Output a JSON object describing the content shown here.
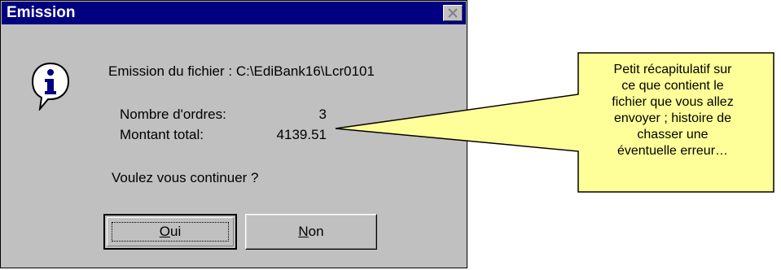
{
  "dialog": {
    "title": "Emission",
    "message": "Emission du fichier : C:\\EdiBank16\\Lcr0101",
    "orders_label": "Nombre d'ordres:",
    "orders_value": "3",
    "total_label": "Montant total:",
    "total_value": "4139.51",
    "question": "Voulez vous continuer ?",
    "ok_mnemonic": "O",
    "ok_rest": "ui",
    "no_mnemonic": "N",
    "no_rest": "on",
    "icon": "info-icon",
    "title_bar_color": "#000080",
    "background_color": "#c0c0c0"
  },
  "callout": {
    "lines": [
      "Petit récapitulatif sur",
      "ce que contient le",
      "fichier que vous allez",
      "envoyer ; histoire de",
      "chasser une",
      "éventuelle erreur…"
    ],
    "background_color": "#ffff99"
  }
}
